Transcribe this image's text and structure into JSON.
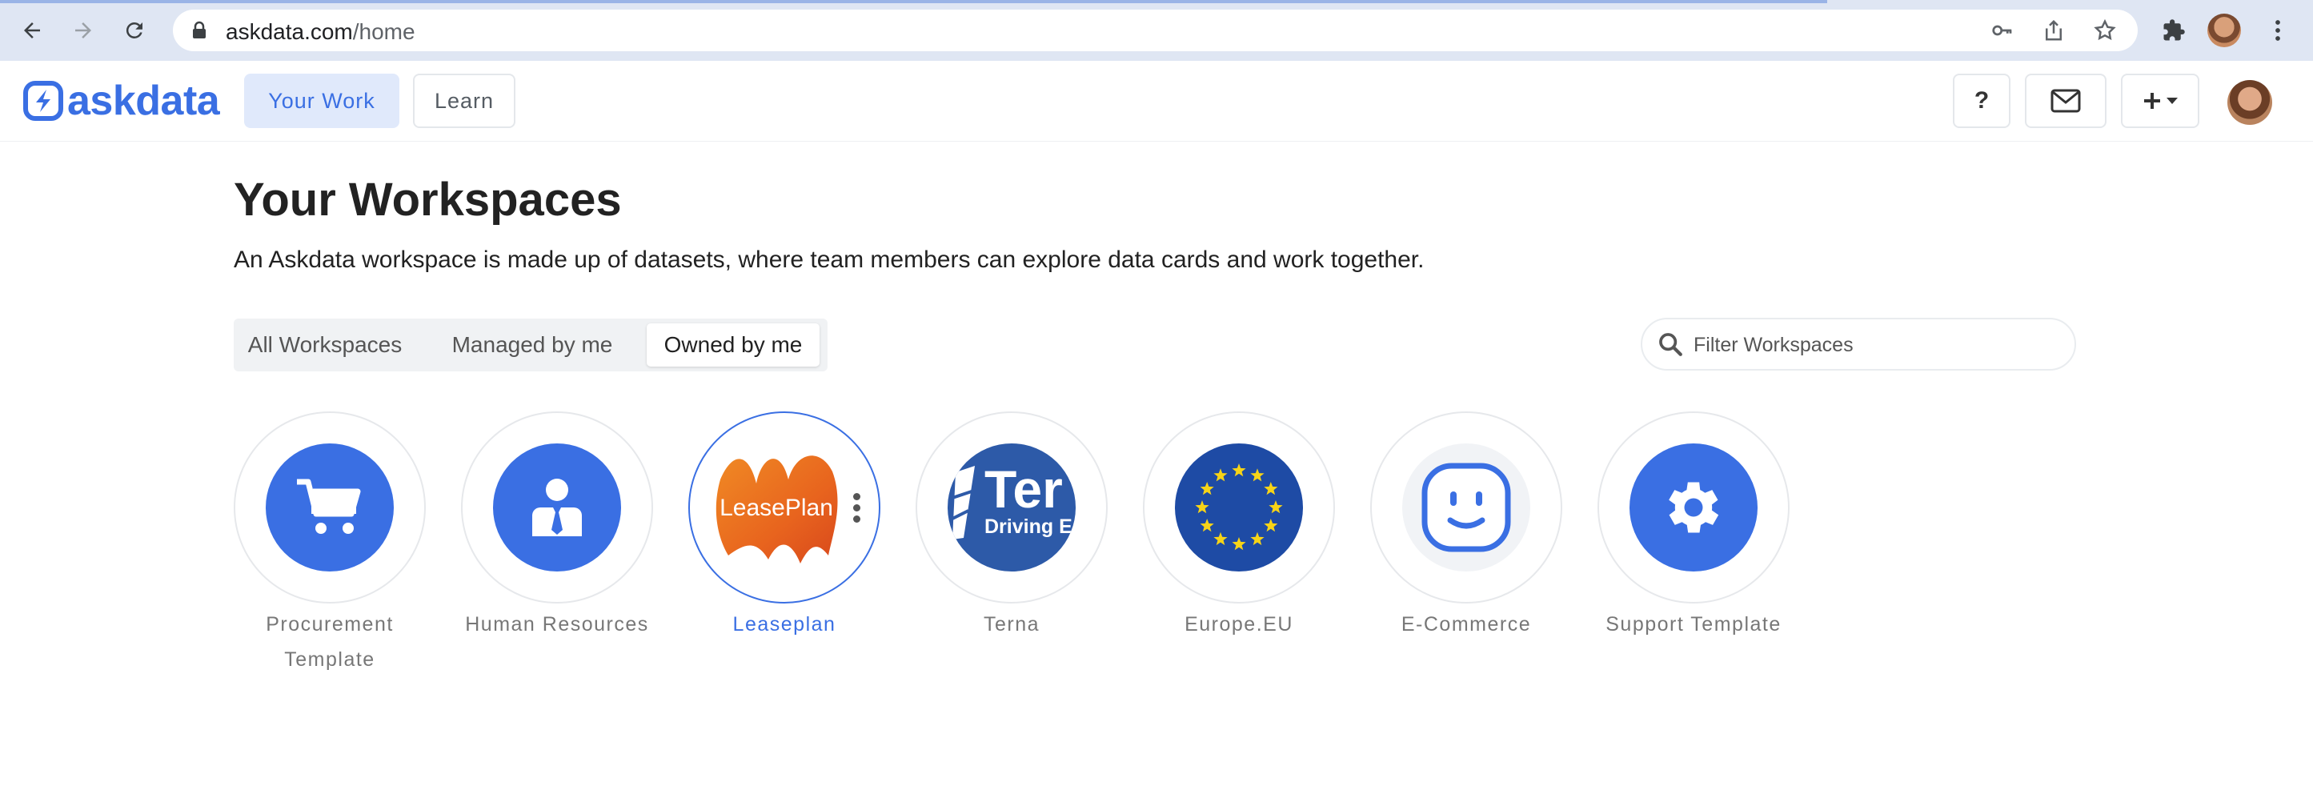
{
  "browser": {
    "url_domain": "askdata.com",
    "url_path": "/home",
    "icons": [
      "back-icon",
      "forward-icon",
      "reload-icon",
      "lock-icon",
      "key-icon",
      "share-icon",
      "star-icon",
      "extensions-icon",
      "profile-avatar",
      "menu-icon"
    ]
  },
  "header": {
    "logo_text": "askdata",
    "tabs": [
      {
        "label": "Your Work",
        "active": true
      },
      {
        "label": "Learn",
        "active": false
      }
    ],
    "help_label": "?",
    "icons": [
      "mail-icon",
      "plus-icon",
      "chevron-down-icon",
      "user-avatar"
    ]
  },
  "main": {
    "title": "Your Workspaces",
    "description": "An Askdata workspace is made up of datasets, where team members can explore data cards and work together.",
    "filters": {
      "options": [
        "All Workspaces",
        "Managed by me",
        "Owned by me"
      ],
      "selected": "Owned by me"
    },
    "search": {
      "placeholder": "Filter Workspaces",
      "value": ""
    },
    "workspaces": [
      {
        "name": "Procurement Template",
        "icon": "cart-icon",
        "color": "#3a6fe3"
      },
      {
        "name": "Human Resources",
        "icon": "person-icon",
        "color": "#3a6fe3"
      },
      {
        "name": "Leaseplan",
        "icon": "leaseplan-logo",
        "logo_text": "LeasePlan",
        "selected": true
      },
      {
        "name": "Terna",
        "icon": "terna-logo",
        "logo_text": "Ter",
        "logo_subtext": "Driving E",
        "color": "#2d5aa8"
      },
      {
        "name": "Europe.EU",
        "icon": "eu-flag-icon",
        "color": "#1e4ba5"
      },
      {
        "name": "E-Commerce",
        "icon": "smiley-icon",
        "color": "#3a6fe3"
      },
      {
        "name": "Support Template",
        "icon": "gear-icon",
        "color": "#3a6fe3"
      }
    ]
  }
}
